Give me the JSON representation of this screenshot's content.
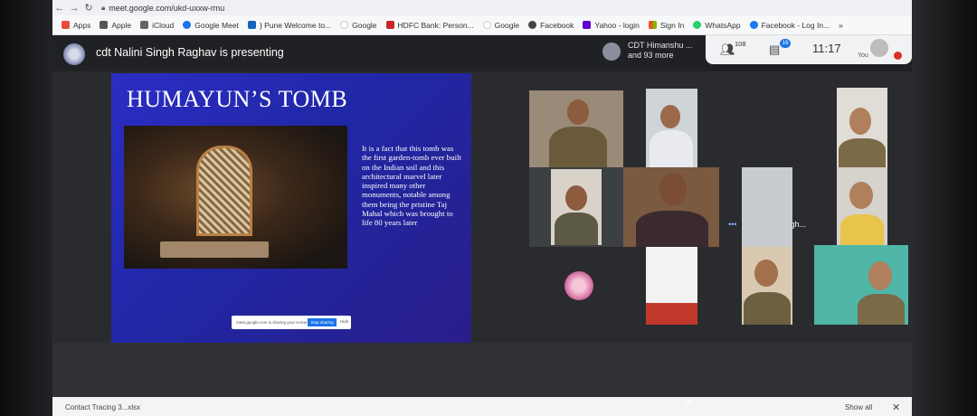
{
  "browser": {
    "url": "meet.google.com/ukd-uxxw-rmu",
    "bookmarks": [
      "Apps",
      "Apple",
      "iCloud",
      "Google Meet",
      "} Pune Welcome to...",
      "Google",
      "HDFC Bank: Person...",
      "Google",
      "Facebook",
      "Yahoo - login",
      "Sign In",
      "WhatsApp",
      "Facebook - Log In..."
    ],
    "more": "»"
  },
  "meet": {
    "presenting_text": "cdt Nalini Singh Raghav is presenting",
    "others_name": "CDT Himanshu ...",
    "others_more": "and 93 more",
    "participants_count": "108",
    "chat_count": "16",
    "time": "11:17",
    "you_label": "You"
  },
  "slide": {
    "title": "HUMAYUN’S TOMB",
    "body": "It is a fact that this tomb was the first garden-tomb ever built on the Indian soil and this architectural marvel later inspired many other monuments, notable among them being the pristine Taj Mahal which was brought to life 80 years later",
    "share_text": "meet.google.com is sharing your screen",
    "stop_label": "Stop sharing",
    "hide_label": "Hide"
  },
  "tiles": {
    "presenter_label": "cdt Nalini Singh..."
  },
  "downloads": {
    "item": "Contact Tracing 3...xlsx",
    "show_all": "Show all"
  },
  "colors": {
    "slide_blue": "#2027a5",
    "accent_teal": "#57c7b5",
    "meet_bg": "#202124"
  }
}
